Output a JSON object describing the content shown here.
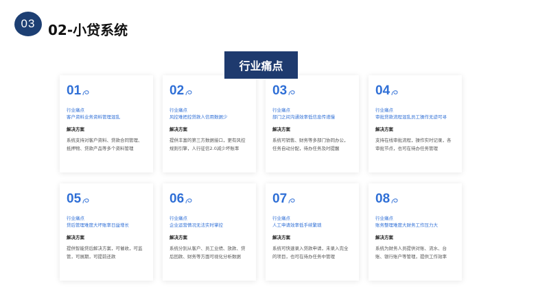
{
  "header": {
    "section_number": "03",
    "title": "02-小贷系统"
  },
  "banner": {
    "title": "行业痛点"
  },
  "cards": [
    {
      "num": "01",
      "pain_label": "行业痛点",
      "pain": "客户资料业务资料管理混乱",
      "solution_label": "解决方案",
      "solution": "系统支持对客户资料、贷款合同管理、抵押物、贷款产品等多个资料管理"
    },
    {
      "num": "02",
      "pain_label": "行业痛点",
      "pain": "风控难把控贷款人信用数据少",
      "solution_label": "解决方案",
      "solution": "提供丰富的第三方数据接口，更有风控规则引擎，人行征信2.0减少坏账率"
    },
    {
      "num": "03",
      "pain_label": "行业痛点",
      "pain": "部门之间沟通效率低信息传递慢",
      "solution_label": "解决方案",
      "solution": "系统可销售、财务等多部门协同办公，任务自动分配，待办任务及时提醒"
    },
    {
      "num": "04",
      "pain_label": "行业痛点",
      "pain": "审批贷款流程混乱员工操作无迹可寻",
      "solution_label": "解决方案",
      "solution": "支持在线审批流程，操作实时记录，各审批节点，也可在待办任务管理"
    },
    {
      "num": "05",
      "pain_label": "行业痛点",
      "pain": "贷后管理难度大坏账率日益增长",
      "solution_label": "解决方案",
      "solution": "提供智能贷后解决方案，可催收，可监管，可展期，可提前还款"
    },
    {
      "num": "06",
      "pain_label": "行业痛点",
      "pain": "企业运营情况无法实时掌控",
      "solution_label": "解决方案",
      "solution": "系统分别从客户、员工业绩、放款、贷后回款、财务等方面可视化分析数据"
    },
    {
      "num": "07",
      "pain_label": "行业痛点",
      "pain": "人工申请效率低手续繁琐",
      "solution_label": "解决方案",
      "solution": "系统可快速录入贷款申请，未录入完全的项目，也可在待办任务中管理"
    },
    {
      "num": "08",
      "pain_label": "行业痛点",
      "pain": "账务整理难度大财务工作压力大",
      "solution_label": "解决方案",
      "solution": "系统为财务人员提供对账、流水、台账、银行账户等管理，提供工作效率"
    }
  ],
  "colors": {
    "accent": "#2f6fd6",
    "navy": "#1e3a6e"
  }
}
